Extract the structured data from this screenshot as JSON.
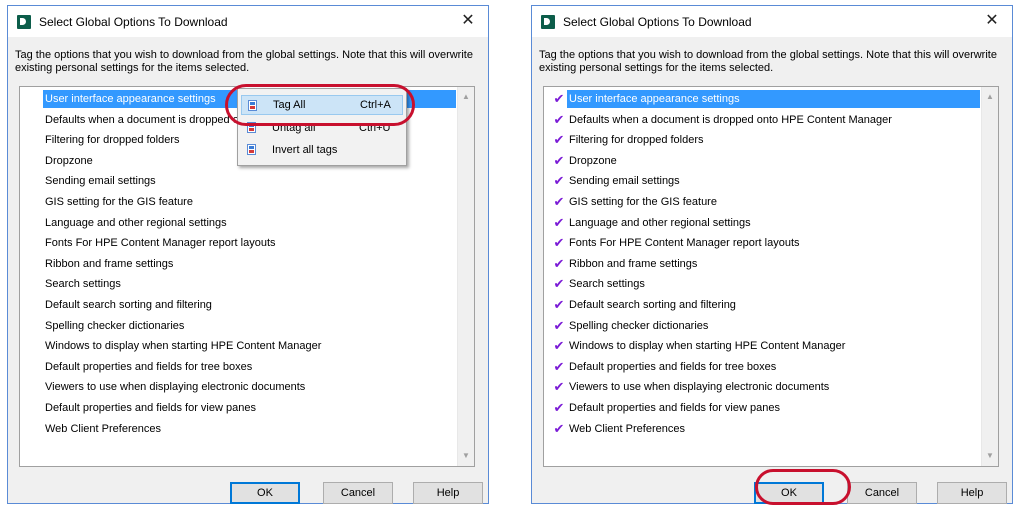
{
  "dialog": {
    "title": "Select Global Options To Download",
    "instruction": "Tag the options that you wish to download from the global settings. Note that this will overwrite existing personal settings for the items selected.",
    "close_symbol": "✕",
    "buttons": {
      "ok": "OK",
      "cancel": "Cancel",
      "help": "Help"
    },
    "check_symbol": "✔",
    "scroll_up": "▲",
    "scroll_down": "▼"
  },
  "left_panel": {
    "items": [
      "User interface appearance settings",
      "Defaults when a document is dropped onto HPE Content Manager",
      "Filtering for dropped folders",
      "Dropzone",
      "Sending email settings",
      "GIS setting for the GIS feature",
      "Language and other regional settings",
      "Fonts For HPE Content Manager report layouts",
      "Ribbon and frame settings",
      "Search settings",
      "Default search sorting and filtering",
      "Spelling checker dictionaries",
      "Windows to display when starting HPE Content Manager",
      "Default properties and fields for tree boxes",
      "Viewers to use when displaying electronic documents",
      "Default properties and fields for view panes",
      "Web Client Preferences"
    ],
    "context_menu": {
      "items": [
        {
          "label": "Tag All",
          "shortcut": "Ctrl+A"
        },
        {
          "label": "Untag all",
          "shortcut": "Ctrl+U"
        },
        {
          "label": "Invert all tags",
          "shortcut": ""
        }
      ]
    }
  },
  "right_panel": {
    "items": [
      "User interface appearance settings",
      "Defaults when a document is dropped onto HPE Content Manager",
      "Filtering for dropped folders",
      "Dropzone",
      "Sending email settings",
      "GIS setting for the GIS feature",
      "Language and other regional settings",
      "Fonts For HPE Content Manager report layouts",
      "Ribbon and frame settings",
      "Search settings",
      "Default search sorting and filtering",
      "Spelling checker dictionaries",
      "Windows to display when starting HPE Content Manager",
      "Default properties and fields for tree boxes",
      "Viewers to use when displaying electronic documents",
      "Default properties and fields for view panes",
      "Web Client Preferences"
    ]
  },
  "colors": {
    "selection": "#3399ff",
    "check": "#7a1ad6",
    "annotation": "#c8102e",
    "default_button_border": "#0078d7"
  },
  "icons": {
    "app": "hpe-content-manager-icon",
    "close": "close-icon",
    "tag": "tag-icon",
    "check": "checkmark-icon"
  }
}
